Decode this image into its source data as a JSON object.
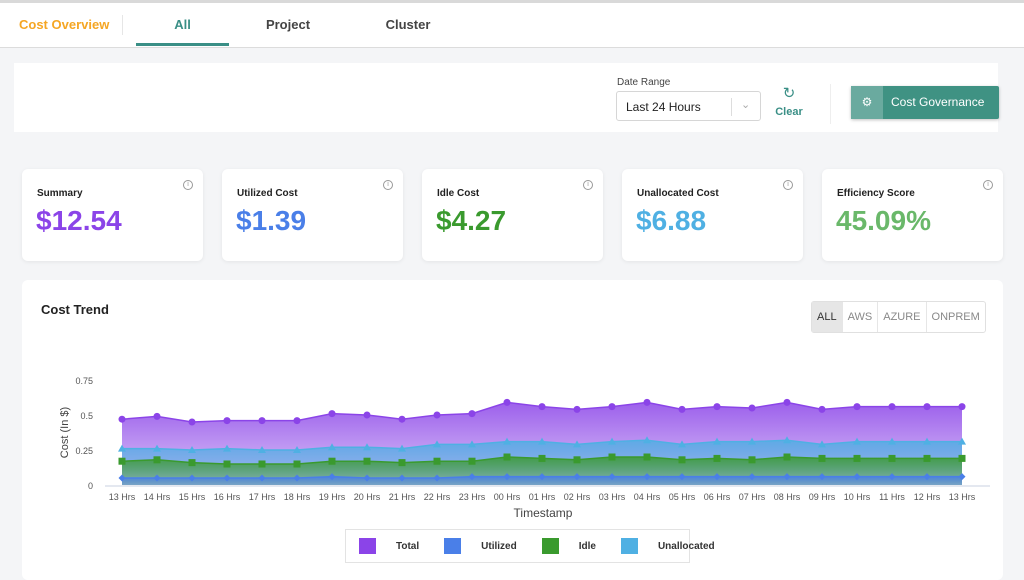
{
  "header": {
    "brand": "Cost Overview",
    "tabs": [
      {
        "label": "All",
        "active": true
      },
      {
        "label": "Project"
      },
      {
        "label": "Cluster"
      }
    ]
  },
  "filters": {
    "date_range_label": "Date Range",
    "date_range_value": "Last 24 Hours",
    "clear_label": "Clear",
    "governance_label": "Cost Governance"
  },
  "cards": [
    {
      "title": "Summary",
      "value": "$12.54",
      "color": "#8b44e8"
    },
    {
      "title": "Utilized Cost",
      "value": "$1.39",
      "color": "#4a7fe8"
    },
    {
      "title": "Idle Cost",
      "value": "$4.27",
      "color": "#3a9a2e"
    },
    {
      "title": "Unallocated Cost",
      "value": "$6.88",
      "color": "#4fb0e3"
    },
    {
      "title": "Efficiency Score",
      "value": "45.09%",
      "color": "#6ab86a"
    }
  ],
  "chart_section": {
    "title": "Cost Trend",
    "providers": [
      "ALL",
      "AWS",
      "AZURE",
      "ONPREM"
    ],
    "selected_provider": "ALL"
  },
  "chart_data": {
    "type": "area",
    "xlabel": "Timestamp",
    "ylabel": "Cost (In $)",
    "ylim": [
      0,
      0.75
    ],
    "yticks": [
      "0",
      "0.25",
      "0.5",
      "0.75"
    ],
    "categories": [
      "13 Hrs",
      "14 Hrs",
      "15 Hrs",
      "16 Hrs",
      "17 Hrs",
      "18 Hrs",
      "19 Hrs",
      "20 Hrs",
      "21 Hrs",
      "22 Hrs",
      "23 Hrs",
      "00 Hrs",
      "01 Hrs",
      "02 Hrs",
      "03 Hrs",
      "04 Hrs",
      "05 Hrs",
      "06 Hrs",
      "07 Hrs",
      "08 Hrs",
      "09 Hrs",
      "10 Hrs",
      "11 Hrs",
      "12 Hrs",
      "13 Hrs"
    ],
    "legend_position": "bottom",
    "series": [
      {
        "name": "Total",
        "color": "#8b44e8",
        "marker": "circle",
        "values": [
          0.47,
          0.49,
          0.45,
          0.46,
          0.46,
          0.46,
          0.51,
          0.5,
          0.47,
          0.5,
          0.51,
          0.59,
          0.56,
          0.54,
          0.56,
          0.59,
          0.54,
          0.56,
          0.55,
          0.59,
          0.54,
          0.56,
          0.56,
          0.56,
          0.56
        ]
      },
      {
        "name": "Unallocated",
        "color": "#4fb0e3",
        "marker": "triangle",
        "values": [
          0.26,
          0.26,
          0.25,
          0.26,
          0.25,
          0.25,
          0.27,
          0.27,
          0.26,
          0.29,
          0.29,
          0.31,
          0.31,
          0.29,
          0.31,
          0.32,
          0.29,
          0.31,
          0.31,
          0.32,
          0.29,
          0.31,
          0.31,
          0.31,
          0.31
        ]
      },
      {
        "name": "Idle",
        "color": "#3a9a2e",
        "marker": "square",
        "values": [
          0.17,
          0.18,
          0.16,
          0.15,
          0.15,
          0.15,
          0.17,
          0.17,
          0.16,
          0.17,
          0.17,
          0.2,
          0.19,
          0.18,
          0.2,
          0.2,
          0.18,
          0.19,
          0.18,
          0.2,
          0.19,
          0.19,
          0.19,
          0.19,
          0.19
        ]
      },
      {
        "name": "Utilized",
        "color": "#4a7fe8",
        "marker": "diamond",
        "values": [
          0.05,
          0.05,
          0.05,
          0.05,
          0.05,
          0.05,
          0.06,
          0.05,
          0.05,
          0.05,
          0.06,
          0.06,
          0.06,
          0.06,
          0.06,
          0.06,
          0.06,
          0.06,
          0.06,
          0.06,
          0.06,
          0.06,
          0.06,
          0.06,
          0.06
        ]
      }
    ],
    "legend": [
      {
        "name": "Total",
        "color": "#8b44e8"
      },
      {
        "name": "Utilized",
        "color": "#4a7fe8"
      },
      {
        "name": "Idle",
        "color": "#3a9a2e"
      },
      {
        "name": "Unallocated",
        "color": "#4fb0e3"
      }
    ]
  }
}
